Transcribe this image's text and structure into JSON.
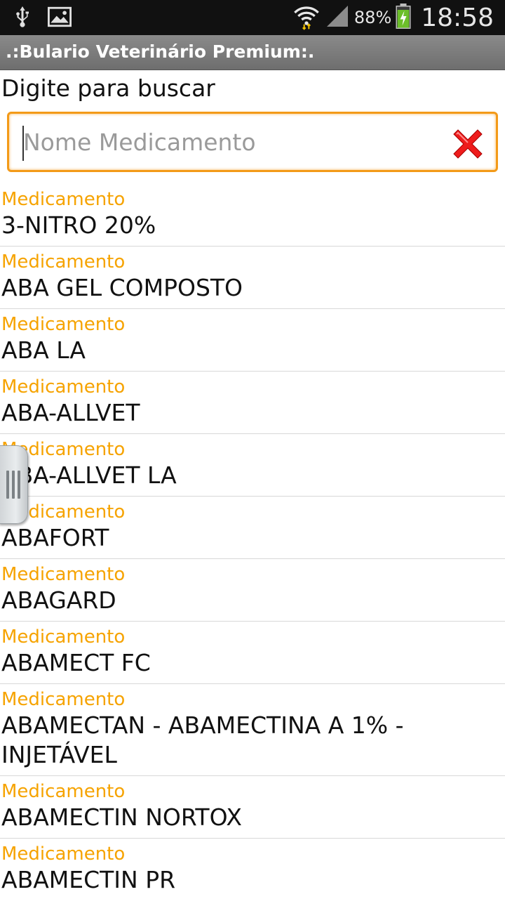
{
  "status_bar": {
    "battery_percent": "88%",
    "time": "18:58",
    "icons": [
      "usb-icon",
      "image-icon",
      "wifi-icon",
      "signal-icon",
      "battery-charging-icon"
    ]
  },
  "app": {
    "title": ".:Bulario Veterinário Premium:."
  },
  "search": {
    "label": "Digite para buscar",
    "placeholder": "Nome Medicamento",
    "value": "",
    "accent_color": "#f39a18"
  },
  "list": {
    "label_color": "#f6a300",
    "items": [
      {
        "label": "Medicamento",
        "name": "3-NITRO 20%"
      },
      {
        "label": "Medicamento",
        "name": "ABA GEL COMPOSTO"
      },
      {
        "label": "Medicamento",
        "name": "ABA LA"
      },
      {
        "label": "Medicamento",
        "name": "ABA-ALLVET"
      },
      {
        "label": "Medicamento",
        "name": "ABA-ALLVET LA"
      },
      {
        "label": "Medicamento",
        "name": "ABAFORT"
      },
      {
        "label": "Medicamento",
        "name": "ABAGARD"
      },
      {
        "label": "Medicamento",
        "name": "ABAMECT FC"
      },
      {
        "label": "Medicamento",
        "name": "ABAMECTAN - ABAMECTINA A 1% - INJETÁVEL"
      },
      {
        "label": "Medicamento",
        "name": "ABAMECTIN NORTOX"
      },
      {
        "label": "Medicamento",
        "name": "ABAMECTIN PR"
      },
      {
        "label": "Medicamento",
        "name": ""
      }
    ]
  }
}
